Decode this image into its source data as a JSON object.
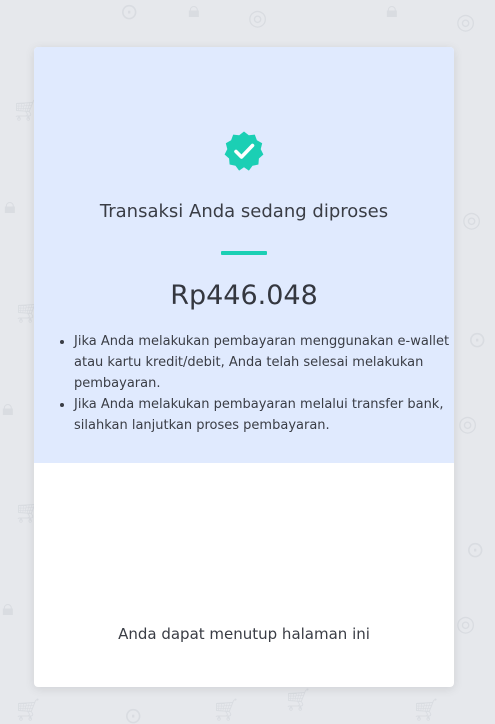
{
  "colors": {
    "accent": "#1bcfb4",
    "card_top_bg": "#e0eafe",
    "page_bg": "#e6e8ec"
  },
  "status": {
    "icon": "verified-check-badge-icon",
    "title": "Transaksi Anda sedang diproses"
  },
  "amount": "Rp446.048",
  "notes": [
    "Jika Anda melakukan pembayaran menggunakan e-wallet atau kartu kredit/debit, Anda telah selesai melakukan pembayaran.",
    "Jika Anda melakukan pembayaran melalui transfer bank, silahkan lanjutkan proses pembayaran."
  ],
  "footer": {
    "message": "Anda dapat menutup halaman ini"
  }
}
